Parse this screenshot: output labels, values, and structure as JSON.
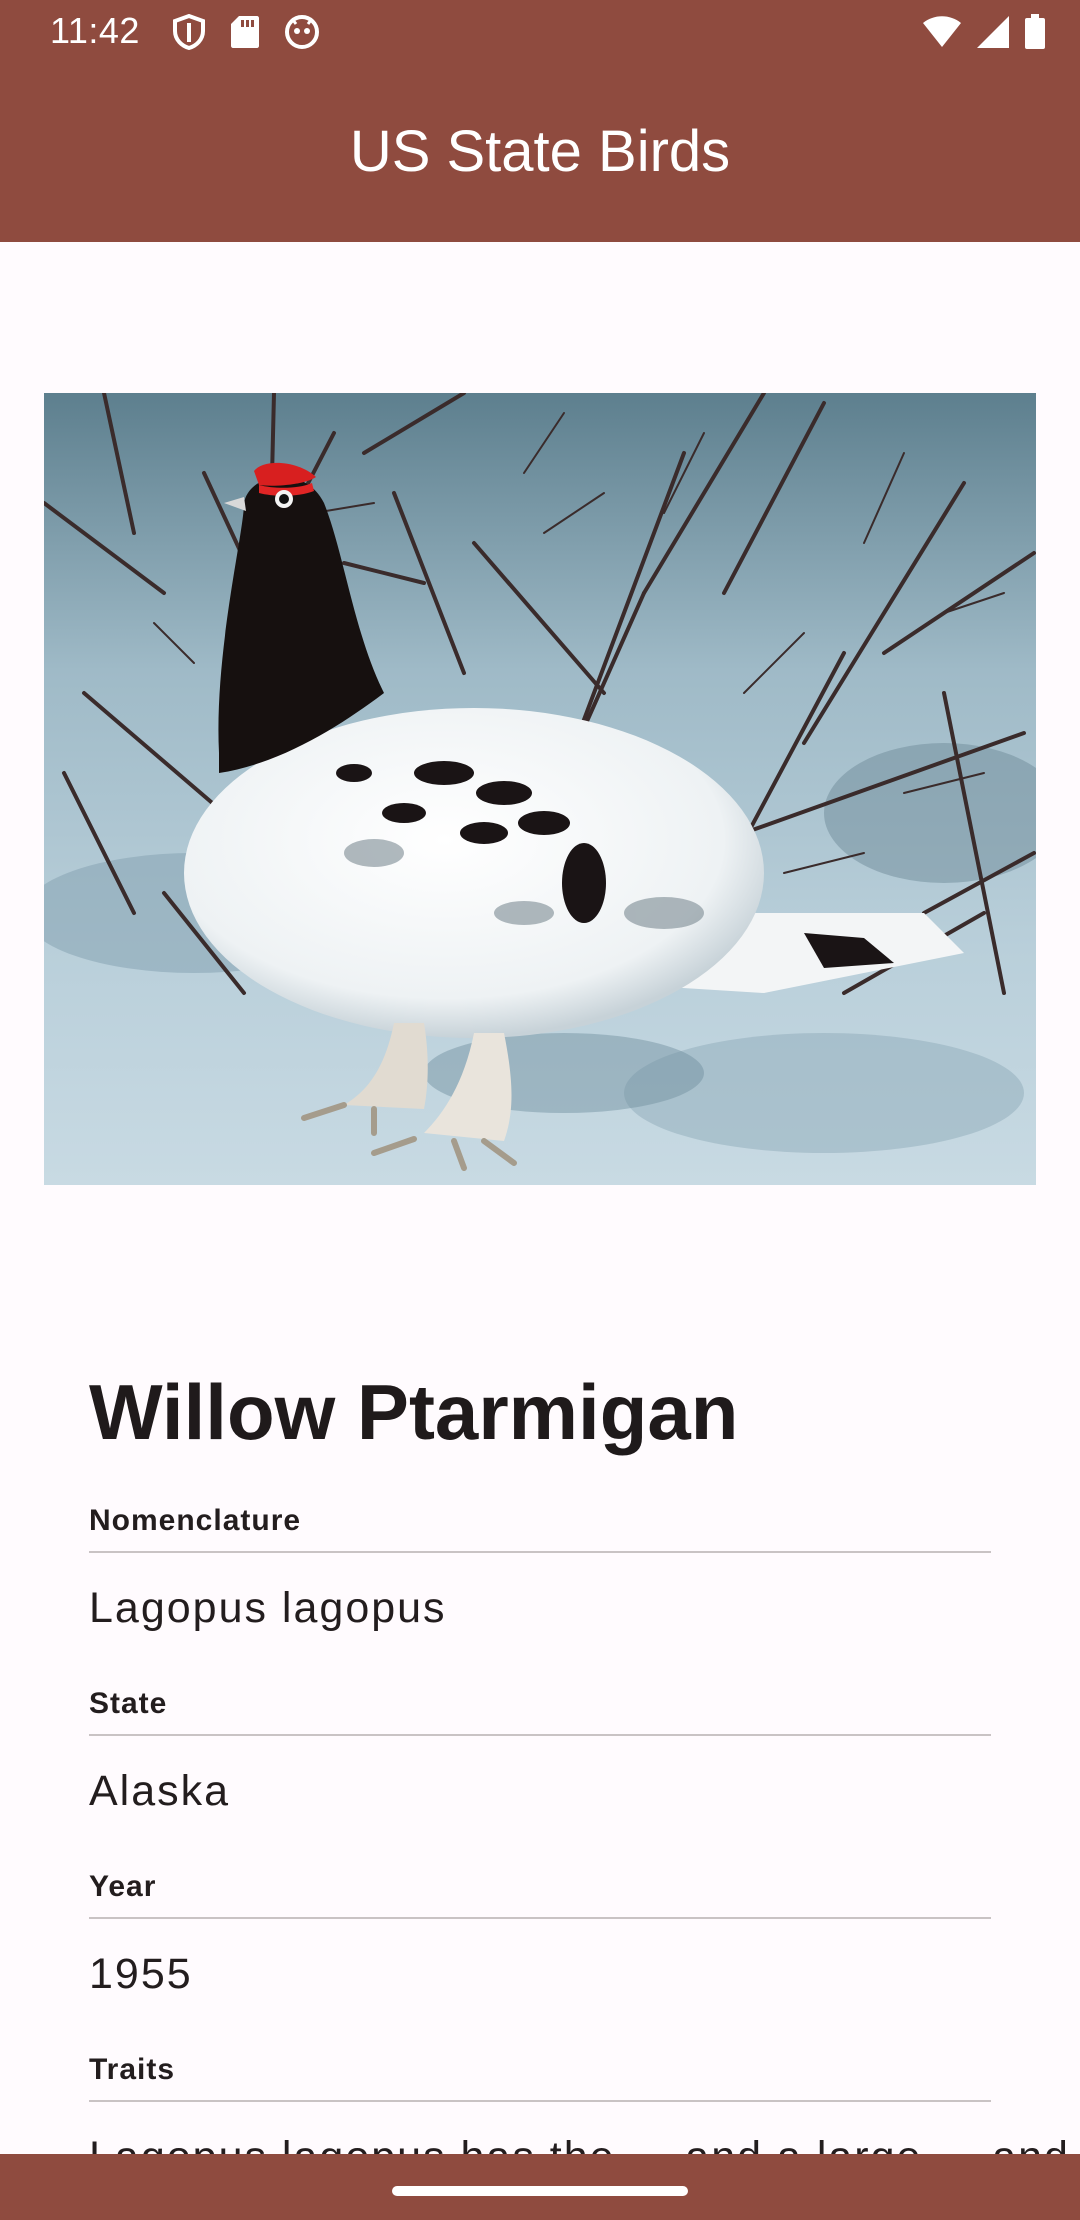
{
  "status_bar": {
    "time": "11:42",
    "left_icons": [
      "shield-icon",
      "sd-card-icon",
      "robot-face-icon"
    ],
    "right_icons": [
      "wifi-icon",
      "cell-signal-icon",
      "battery-icon"
    ]
  },
  "app_bar": {
    "title": "US State Birds"
  },
  "bird": {
    "image_description_icon": "photo-image",
    "name": "Willow Ptarmigan",
    "fields": [
      {
        "label": "Nomenclature",
        "value": "Lagopus lagopus"
      },
      {
        "label": "State",
        "value": "Alaska"
      },
      {
        "label": "Year",
        "value": "1955"
      },
      {
        "label": "Traits",
        "value": "Lagopus lagopus has the ... and a large ... and ..."
      }
    ]
  },
  "colors": {
    "primary": "#8f4b3f",
    "background": "#fffbfe",
    "text": "#231d1e",
    "divider": "#c9c3c4"
  }
}
